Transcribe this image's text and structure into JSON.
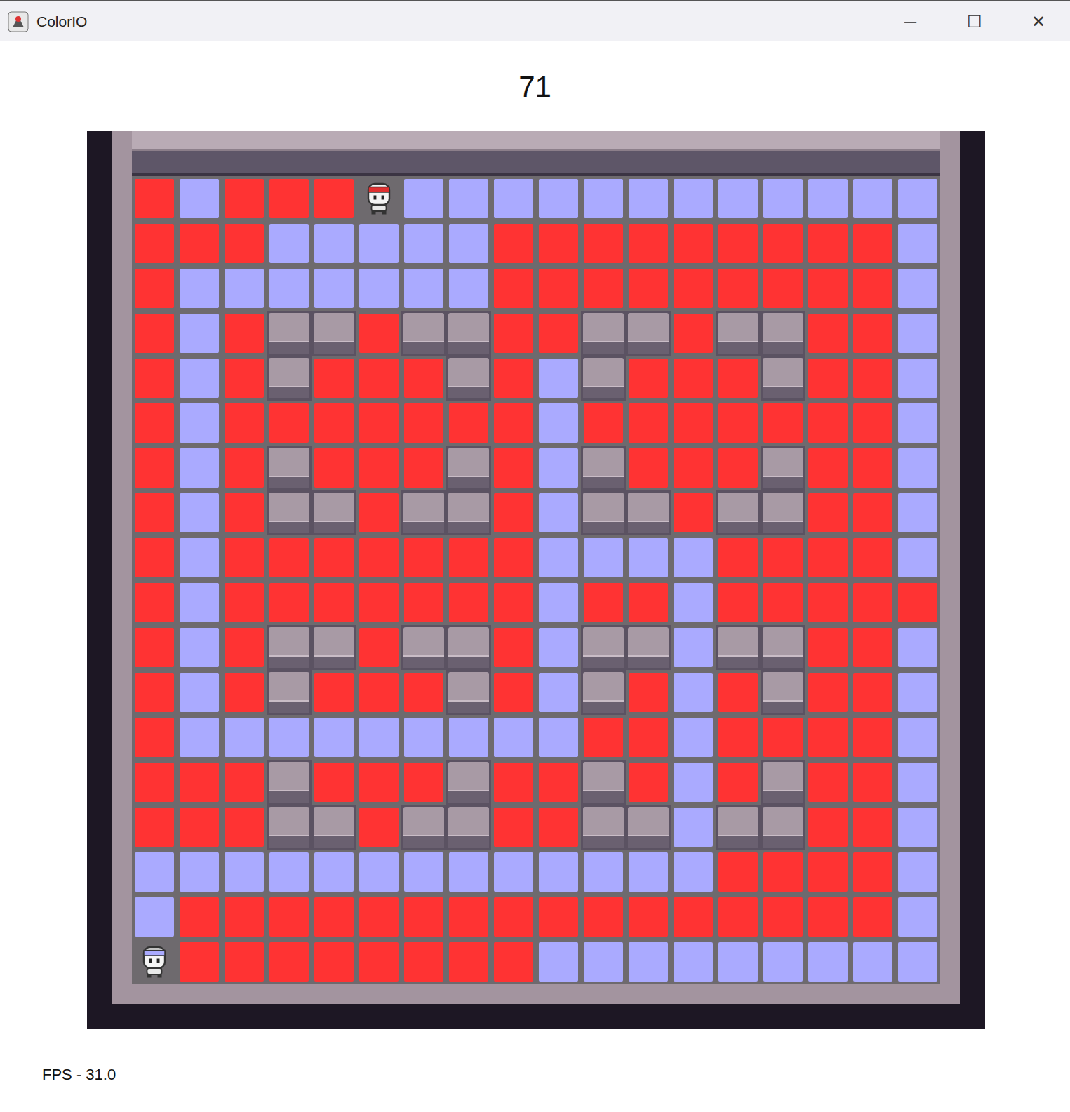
{
  "window": {
    "title": "ColorIO",
    "controls": [
      "─",
      "☐",
      "✕"
    ]
  },
  "score": "71",
  "fps": "FPS - 31.0",
  "legend": {
    "R": {
      "kind": "tile",
      "color": "#ff3333"
    },
    "B": {
      "kind": "tile",
      "color": "#aaaaff"
    },
    "W": {
      "kind": "wall"
    },
    "1": {
      "kind": "player",
      "color": "#e03030"
    },
    "2": {
      "kind": "player",
      "color": "#aaaaff"
    }
  },
  "board": {
    "rows": [
      "RBRRR1BBBBBBBBBBBB",
      "RRRBBBBBRRRRRRRRRB",
      "RBBBBBBBRRRRRRRRRB",
      "RBRWWRWWRRWWRWWRRB",
      "RBRWRRRWRBWRRRWRRB",
      "RBRRRRRRRBRRRRRRRB",
      "RBRWRRRWRBWRRRWRRB",
      "RBRWWRWWRBWWRWWRRB",
      "RBRRRRRRRBBBBRRRRB",
      "RBRRRRRRRBRRBRRRRR",
      "RBRWWRWWRBWWBWWRRB",
      "RBRWRRRWRBWRBRWRRB",
      "RBBBBBBBBBRRBRRRRB",
      "RRRWRRRWRRWRBRWRRB",
      "RRRWWRWWRRWWBWWRRB",
      "BBBBBBBBBBBBBRRRRB",
      "BRRRRRRRRRRRRRRRRB",
      "2RRRRRRRRBBBBBBBBB"
    ]
  }
}
